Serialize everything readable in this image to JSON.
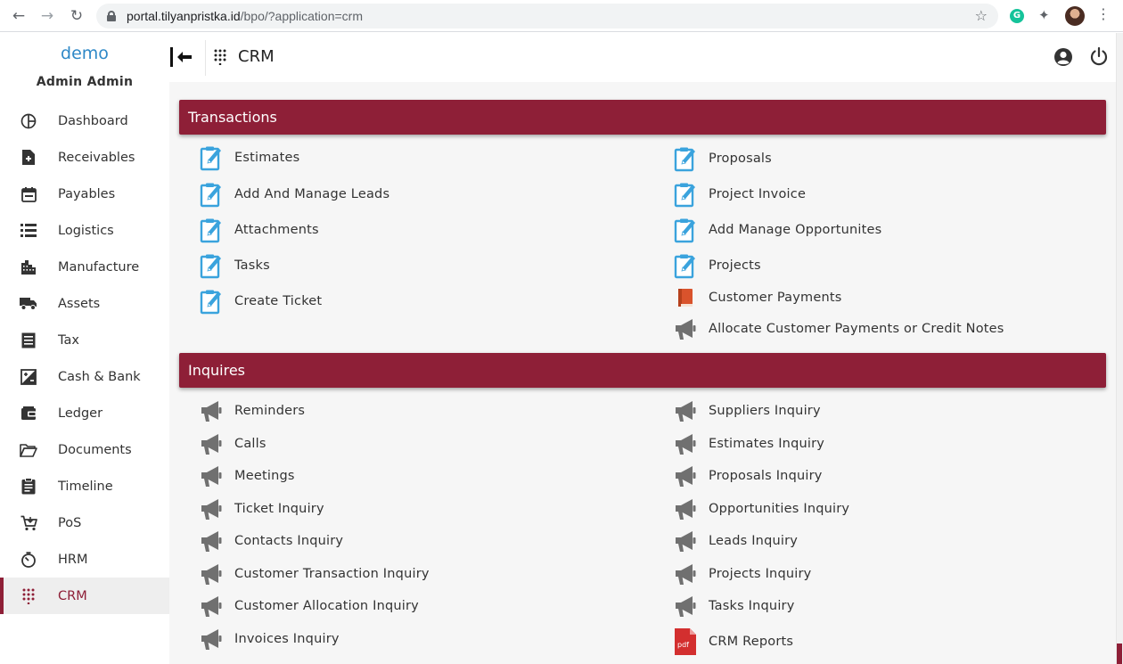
{
  "browser": {
    "url_host": "portal.tilyanpristka.id",
    "url_path": "/bpo/?application=crm",
    "extension_g_label": "G"
  },
  "sidebar": {
    "brand": "demo",
    "user": "Admin Admin",
    "items": [
      {
        "label": "Dashboard",
        "icon": "dashboard-icon"
      },
      {
        "label": "Receivables",
        "icon": "receivables-icon"
      },
      {
        "label": "Payables",
        "icon": "payables-icon"
      },
      {
        "label": "Logistics",
        "icon": "logistics-icon"
      },
      {
        "label": "Manufacture",
        "icon": "manufacture-icon"
      },
      {
        "label": "Assets",
        "icon": "truck-icon"
      },
      {
        "label": "Tax",
        "icon": "tax-icon"
      },
      {
        "label": "Cash & Bank",
        "icon": "cash-bank-icon"
      },
      {
        "label": "Ledger",
        "icon": "ledger-icon"
      },
      {
        "label": "Documents",
        "icon": "folder-icon"
      },
      {
        "label": "Timeline",
        "icon": "clipboard-icon"
      },
      {
        "label": "PoS",
        "icon": "cart-icon"
      },
      {
        "label": "HRM",
        "icon": "timer-icon"
      },
      {
        "label": "CRM",
        "icon": "grid-dots-icon",
        "active": true
      }
    ]
  },
  "topbar": {
    "title": "CRM"
  },
  "sections": {
    "transactions": {
      "title": "Transactions",
      "left": [
        "Estimates",
        "Add And Manage Leads",
        "Attachments",
        "Tasks",
        "Create Ticket"
      ],
      "right": [
        "Proposals",
        "Project Invoice",
        "Add Manage Opportunites",
        "Projects",
        "Customer Payments",
        "Allocate Customer Payments or Credit Notes"
      ]
    },
    "inquires": {
      "title": "Inquires",
      "left": [
        "Reminders",
        "Calls",
        "Meetings",
        "Ticket Inquiry",
        "Contacts Inquiry",
        "Customer Transaction Inquiry",
        "Customer Allocation Inquiry",
        "Invoices Inquiry"
      ],
      "right": [
        "Suppliers Inquiry",
        "Estimates Inquiry",
        "Proposals Inquiry",
        "Opportunities Inquiry",
        "Leads Inquiry",
        "Projects Inquiry",
        "Tasks Inquiry",
        "CRM Reports"
      ]
    }
  },
  "icons": {
    "pdf_label": "pdf"
  },
  "colors": {
    "accent": "#8e1f37",
    "brand": "#2e88c7",
    "edit_icon": "#3aa3dd",
    "megaphone": "#707070"
  }
}
